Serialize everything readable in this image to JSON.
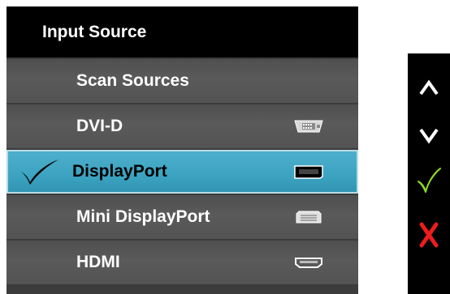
{
  "menu": {
    "title": "Input Source",
    "items": [
      {
        "label": "Scan Sources",
        "icon": null,
        "selected": false
      },
      {
        "label": "DVI-D",
        "icon": "dvi-port-icon",
        "selected": false
      },
      {
        "label": "DisplayPort",
        "icon": "displayport-port-icon",
        "selected": true
      },
      {
        "label": "Mini DisplayPort",
        "icon": "mini-displayport-port-icon",
        "selected": false
      },
      {
        "label": "HDMI",
        "icon": "hdmi-port-icon",
        "selected": false
      }
    ],
    "selected_indicator": "checkmark-icon"
  },
  "buttons": [
    {
      "name": "up-button",
      "icon": "chevron-up-icon",
      "color": "#ffffff"
    },
    {
      "name": "down-button",
      "icon": "chevron-down-icon",
      "color": "#ffffff"
    },
    {
      "name": "ok-button",
      "icon": "checkmark-icon",
      "color": "#8fdc1e"
    },
    {
      "name": "exit-button",
      "icon": "close-icon",
      "color": "#ee1c1c"
    }
  ],
  "colors": {
    "header_bg": "#000000",
    "row_bg": "#555555",
    "selected_row_bg": "#3aa3c2",
    "label_text": "#ffffff",
    "selected_label_text": "#000000"
  }
}
